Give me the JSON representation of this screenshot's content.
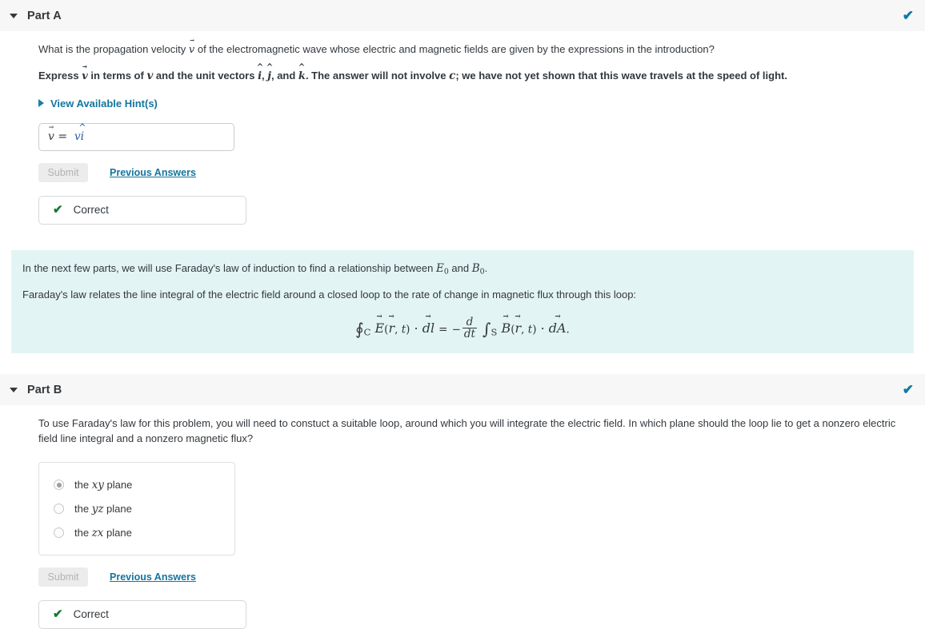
{
  "parts": [
    {
      "id": "part-a",
      "title": "Part A",
      "status_icon": "check-icon",
      "status_color": "#0a7ca5",
      "question": {
        "line1_pre": "What is the propagation velocity ",
        "line1_sym": "v",
        "line1_post": " of the electromagnetic wave whose electric and magnetic fields are given by the expressions in the introduction?",
        "line2_a": "Express ",
        "line2_sym": "v",
        "line2_b": " in terms of ",
        "line2_v": "v",
        "line2_c": " and the unit vectors ",
        "line2_i": "i",
        "line2_comma1": ", ",
        "line2_j": "j",
        "line2_comma2": ", and ",
        "line2_k": "k",
        "line2_d": ". The answer will not involve ",
        "line2_c_sym": "c",
        "line2_e": "; we have not yet shown that this wave travels at the speed of light."
      },
      "hints_label": "View Available Hint(s)",
      "answer": {
        "lhs_sym": "v",
        "equals": " = ",
        "value_scalar": "v",
        "value_unit": "i"
      },
      "submit_label": "Submit",
      "previous_answers_label": "Previous Answers",
      "feedback": {
        "icon": "check-icon",
        "label": "Correct",
        "color": "#127a31"
      }
    },
    {
      "id": "part-b",
      "title": "Part B",
      "status_icon": "check-icon",
      "status_color": "#0a7ca5",
      "question": {
        "text": "To use Faraday's law for this problem, you will need to constuct a suitable loop, around which you will integrate the electric field. In which plane should the loop lie to get a nonzero electric field line integral and a nonzero magnetic flux?"
      },
      "choices": [
        {
          "prefix": "the ",
          "sym": "xy",
          "suffix": " plane",
          "selected": true
        },
        {
          "prefix": "the ",
          "sym": "yz",
          "suffix": " plane",
          "selected": false
        },
        {
          "prefix": "the ",
          "sym": "zx",
          "suffix": " plane",
          "selected": false
        }
      ],
      "submit_label": "Submit",
      "previous_answers_label": "Previous Answers",
      "feedback": {
        "icon": "check-icon",
        "label": "Correct",
        "color": "#127a31"
      }
    }
  ],
  "info_panel": {
    "background": "#e3f4f4",
    "line1_a": "In the next few parts, we will use Faraday's law of induction to find a relationship between ",
    "line1_E": "E",
    "line1_E_sub": "0",
    "line1_b": " and ",
    "line1_B": "B",
    "line1_B_sub": "0",
    "line1_c": ".",
    "line2": "Faraday's law relates the line integral of the electric field around a closed loop to the rate of change in magnetic flux through this loop:",
    "equation": {
      "contour_op": "∮",
      "contour_sub": "C",
      "E_sym": "E",
      "arg": "(r, t)",
      "dot": "·",
      "dl": "dl",
      "equals": "=",
      "minus": "−",
      "frac_num": "d",
      "frac_den": "dt",
      "integral_op": "∫",
      "integral_sub": "S",
      "B_sym": "B",
      "dA": "dA",
      "plain": "∮_C E(r,t) · dl = − d/dt ∫_S B(r,t) · dA"
    }
  },
  "icons": {
    "caret_down": "caret-down-icon",
    "caret_right": "caret-right-icon",
    "check": "check-icon"
  }
}
